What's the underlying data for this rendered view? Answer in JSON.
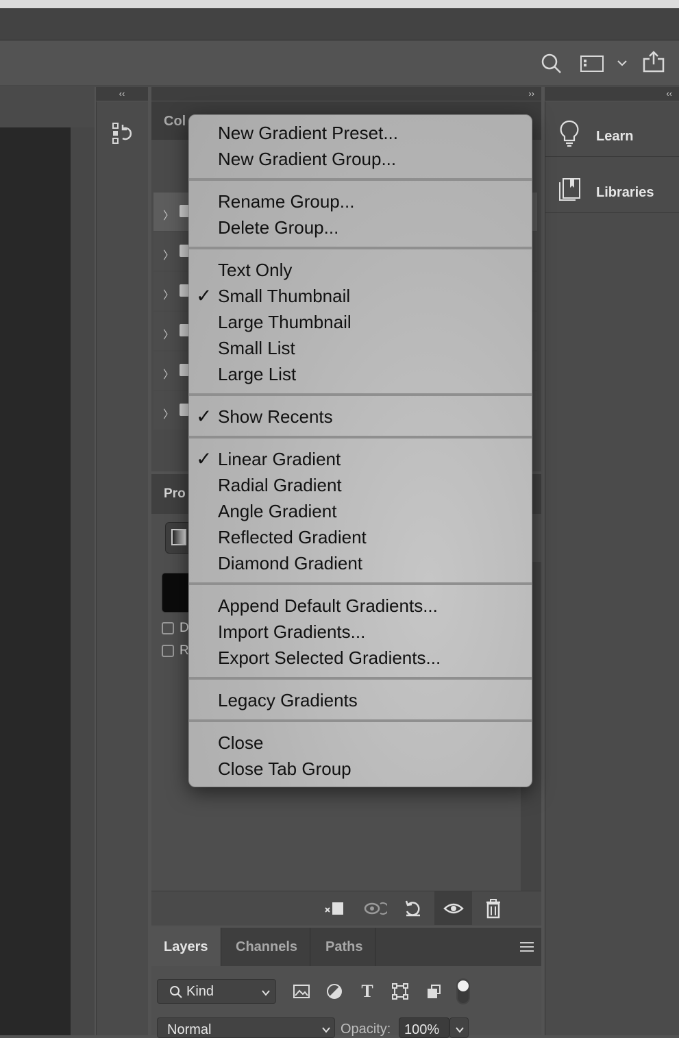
{
  "window": {
    "options_bar": {
      "workspace_icon": "workspace-icon",
      "search_icon": "search-icon",
      "share_icon": "share-icon"
    }
  },
  "panels": {
    "collapse_left": "‹‹",
    "collapse_mid": "››",
    "collapse_right": "‹‹",
    "gradients_tab_partial": "Col",
    "properties_title_partial": "Pro",
    "properties_checkbox_1_partial": "D",
    "properties_checkbox_2_partial": "R"
  },
  "right_dock": {
    "items": [
      {
        "label": "Learn",
        "icon": "lightbulb-icon"
      },
      {
        "label": "Libraries",
        "icon": "libraries-icon"
      }
    ]
  },
  "flyout_menu": {
    "groups": [
      [
        {
          "label": "New Gradient Preset...",
          "checked": false
        },
        {
          "label": "New Gradient Group...",
          "checked": false
        }
      ],
      [
        {
          "label": "Rename Group...",
          "checked": false
        },
        {
          "label": "Delete Group...",
          "checked": false
        }
      ],
      [
        {
          "label": "Text Only",
          "checked": false
        },
        {
          "label": "Small Thumbnail",
          "checked": true
        },
        {
          "label": "Large Thumbnail",
          "checked": false
        },
        {
          "label": "Small List",
          "checked": false
        },
        {
          "label": "Large List",
          "checked": false
        }
      ],
      [
        {
          "label": "Show Recents",
          "checked": true
        }
      ],
      [
        {
          "label": "Linear Gradient",
          "checked": true
        },
        {
          "label": "Radial Gradient",
          "checked": false
        },
        {
          "label": "Angle Gradient",
          "checked": false
        },
        {
          "label": "Reflected Gradient",
          "checked": false
        },
        {
          "label": "Diamond Gradient",
          "checked": false
        }
      ],
      [
        {
          "label": "Append Default Gradients...",
          "checked": false
        },
        {
          "label": "Import Gradients...",
          "checked": false
        },
        {
          "label": "Export Selected Gradients...",
          "checked": false
        }
      ],
      [
        {
          "label": "Legacy Gradients",
          "checked": false
        }
      ],
      [
        {
          "label": "Close",
          "checked": false
        },
        {
          "label": "Close Tab Group",
          "checked": false
        }
      ]
    ],
    "checkmark": "✓"
  },
  "layers_panel": {
    "tabs": [
      "Layers",
      "Channels",
      "Paths"
    ],
    "filter_kind": "Kind",
    "blend_mode": "Normal",
    "opacity_label": "Opacity:",
    "opacity_value": "100%"
  },
  "colors": {
    "panel_bg": "#535353",
    "menu_bg": "#b8b8b8"
  }
}
